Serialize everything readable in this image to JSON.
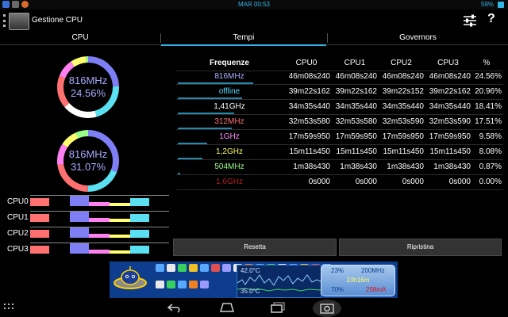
{
  "status_bar": {
    "time": "MAR 00:53",
    "battery": "59%"
  },
  "app": {
    "title": "Gestione CPU",
    "help": "?"
  },
  "tabs": [
    {
      "label": "CPU"
    },
    {
      "label": "Tempi"
    },
    {
      "label": "Governors"
    }
  ],
  "selected_tab": "Tempi",
  "rings": [
    {
      "freq": "816MHz",
      "percent": "24.56%"
    },
    {
      "freq": "816MHz",
      "percent": "31.07%"
    }
  ],
  "cpu_bars": [
    {
      "label": "CPU0"
    },
    {
      "label": "CPU1"
    },
    {
      "label": "CPU2"
    },
    {
      "label": "CPU3"
    }
  ],
  "table": {
    "headers": {
      "freq": "Frequenze",
      "cpu0": "CPU0",
      "cpu1": "CPU1",
      "cpu2": "CPU2",
      "cpu3": "CPU3",
      "pct": "%"
    },
    "rows": [
      {
        "freq": "816MHz",
        "color": "#b0b0ff",
        "cpu0": "46m08s240",
        "cpu1": "46m08s240",
        "cpu2": "46m08s240",
        "cpu3": "46m08s240",
        "pct": "24.56%",
        "share": 0.2456
      },
      {
        "freq": "offline",
        "color": "#5ad8f8",
        "cpu0": "39m22s162",
        "cpu1": "39m22s162",
        "cpu2": "39m22s152",
        "cpu3": "39m22s162",
        "pct": "20.96%",
        "share": 0.2096
      },
      {
        "freq": "1,41GHz",
        "color": "#ffffff",
        "cpu0": "34m35s440",
        "cpu1": "34m35s440",
        "cpu2": "34m35s440",
        "cpu3": "34m35s440",
        "pct": "18.41%",
        "share": 0.1841
      },
      {
        "freq": "312MHz",
        "color": "#ff7070",
        "cpu0": "32m53s580",
        "cpu1": "32m53s580",
        "cpu2": "32m53s590",
        "cpu3": "32m53s590",
        "pct": "17.51%",
        "share": 0.1751
      },
      {
        "freq": "1GHz",
        "color": "#ff8cff",
        "cpu0": "17m59s950",
        "cpu1": "17m59s950",
        "cpu2": "17m59s950",
        "cpu3": "17m59s950",
        "pct": "9.58%",
        "share": 0.0958
      },
      {
        "freq": "1,2GHz",
        "color": "#ffff66",
        "cpu0": "15m11s450",
        "cpu1": "15m11s450",
        "cpu2": "15m11s450",
        "cpu3": "15m11s450",
        "pct": "8.08%",
        "share": 0.0808
      },
      {
        "freq": "504MHz",
        "color": "#9aff88",
        "cpu0": "1m38s430",
        "cpu1": "1m38s430",
        "cpu2": "1m38s430",
        "cpu3": "1m38s430",
        "pct": "0.87%",
        "share": 0.0087
      },
      {
        "freq": "1,6GHz",
        "color": "#b02020",
        "cpu0": "0s000",
        "cpu1": "0s000",
        "cpu2": "0s000",
        "cpu3": "0s000",
        "pct": "0.00%",
        "share": 0.0
      }
    ]
  },
  "buttons": {
    "reset": "Resetta",
    "restore": "Ripristina"
  },
  "banner": {
    "temp1": "42.0°C",
    "temp2": "35.0°C",
    "load": "23%",
    "freq": "200MHz",
    "uptime": "23h16m",
    "battery": "70%",
    "current": "258mA"
  },
  "colors": {
    "accent": "#33b5e5",
    "ring_blue": "#7f7ff5",
    "ring_cyan": "#5ae0f0",
    "ring_red": "#ff7070",
    "ring_yellow": "#ffff70",
    "ring_pink": "#ff80f0"
  }
}
